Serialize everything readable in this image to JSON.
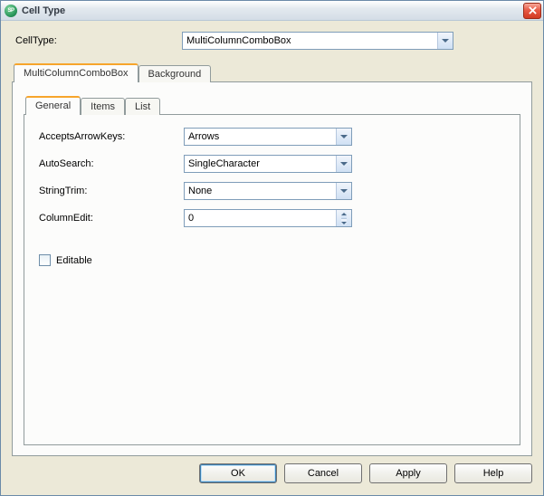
{
  "window": {
    "title": "Cell Type"
  },
  "celltype": {
    "label": "CellType:",
    "value": "MultiColumnComboBox"
  },
  "outerTabs": {
    "items": [
      {
        "label": "MultiColumnComboBox",
        "active": true
      },
      {
        "label": "Background",
        "active": false
      }
    ]
  },
  "innerTabs": {
    "items": [
      {
        "label": "General",
        "active": true
      },
      {
        "label": "Items",
        "active": false
      },
      {
        "label": "List",
        "active": false
      }
    ]
  },
  "general": {
    "acceptsArrowKeys": {
      "label": "AcceptsArrowKeys:",
      "value": "Arrows"
    },
    "autoSearch": {
      "label": "AutoSearch:",
      "value": "SingleCharacter"
    },
    "stringTrim": {
      "label": "StringTrim:",
      "value": "None"
    },
    "columnEdit": {
      "label": "ColumnEdit:",
      "value": "0"
    },
    "editable": {
      "label": "Editable",
      "checked": false
    }
  },
  "buttons": {
    "ok": "OK",
    "cancel": "Cancel",
    "apply": "Apply",
    "help": "Help"
  }
}
